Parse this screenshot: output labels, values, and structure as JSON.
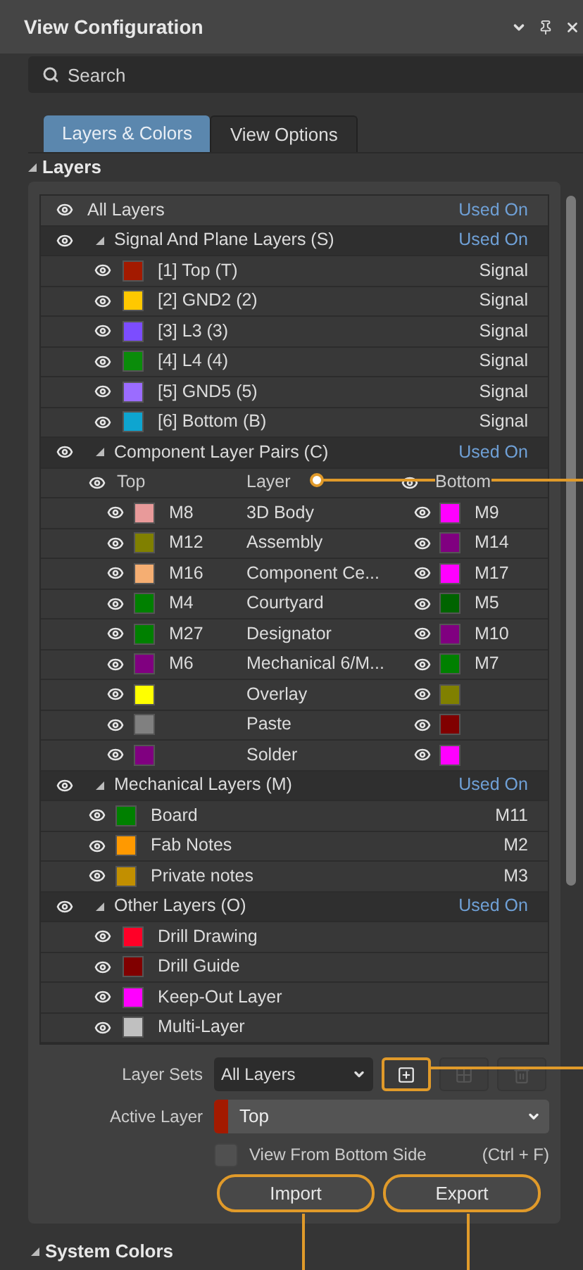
{
  "window": {
    "title": "View Configuration"
  },
  "search": {
    "placeholder": "Search"
  },
  "tabs": [
    {
      "label": "Layers & Colors",
      "selected": true
    },
    {
      "label": "View Options",
      "selected": false
    }
  ],
  "section": {
    "title": "Layers"
  },
  "tree": {
    "all_layers": {
      "label": "All Layers",
      "used_on": "Used On"
    },
    "groups": [
      {
        "kind": "signal",
        "label": "Signal And Plane Layers (S)",
        "used_on": "Used On",
        "children": [
          {
            "label": "[1] Top (T)",
            "color": "#a31a00",
            "value": "Signal"
          },
          {
            "label": "[2] GND2 (2)",
            "color": "#ffc800",
            "value": "Signal"
          },
          {
            "label": "[3] L3 (3)",
            "color": "#7c4dff",
            "value": "Signal"
          },
          {
            "label": "[4] L4 (4)",
            "color": "#0a8c0a",
            "value": "Signal"
          },
          {
            "label": "[5] GND5 (5)",
            "color": "#9b6cff",
            "value": "Signal"
          },
          {
            "label": "[6] Bottom (B)",
            "color": "#0ea5d0",
            "value": "Signal"
          }
        ]
      },
      {
        "kind": "pairs",
        "label": "Component Layer Pairs (C)",
        "used_on": "Used On",
        "header": {
          "top": "Top",
          "layer": "Layer",
          "bottom": "Bottom"
        },
        "children": [
          {
            "top": {
              "code": "M8",
              "color": "#e89a9a"
            },
            "layer": "3D Body",
            "bottom": {
              "code": "M9",
              "color": "#ff00ff"
            }
          },
          {
            "top": {
              "code": "M12",
              "color": "#808000"
            },
            "layer": "Assembly",
            "bottom": {
              "code": "M14",
              "color": "#800080"
            }
          },
          {
            "top": {
              "code": "M16",
              "color": "#f5ae72"
            },
            "layer": "Component Ce...",
            "bottom": {
              "code": "M17",
              "color": "#ff00ff"
            }
          },
          {
            "top": {
              "code": "M4",
              "color": "#008000"
            },
            "layer": "Courtyard",
            "bottom": {
              "code": "M5",
              "color": "#006400"
            }
          },
          {
            "top": {
              "code": "M27",
              "color": "#008000"
            },
            "layer": "Designator",
            "bottom": {
              "code": "M10",
              "color": "#800080"
            }
          },
          {
            "top": {
              "code": "M6",
              "color": "#800080"
            },
            "layer": "Mechanical 6/M...",
            "bottom": {
              "code": "M7",
              "color": "#008000"
            }
          },
          {
            "top": {
              "color": "#ffff00"
            },
            "layer": "Overlay",
            "bottom": {
              "color": "#808000"
            }
          },
          {
            "top": {
              "color": "#808080"
            },
            "layer": "Paste",
            "bottom": {
              "color": "#800000"
            }
          },
          {
            "top": {
              "color": "#800080"
            },
            "layer": "Solder",
            "bottom": {
              "color": "#ff00ff"
            }
          }
        ]
      },
      {
        "kind": "mechanical",
        "label": "Mechanical Layers (M)",
        "used_on": "Used On",
        "children": [
          {
            "label": "Board",
            "color": "#008000",
            "value": "M11"
          },
          {
            "label": "Fab Notes",
            "color": "#ff9900",
            "value": "M2"
          },
          {
            "label": "Private notes",
            "color": "#c28f00",
            "value": "M3"
          }
        ]
      },
      {
        "kind": "other",
        "label": "Other Layers (O)",
        "used_on": "Used On",
        "children": [
          {
            "label": "Drill Drawing",
            "color": "#ff0027"
          },
          {
            "label": "Drill Guide",
            "color": "#800000"
          },
          {
            "label": "Keep-Out Layer",
            "color": "#ff00ff"
          },
          {
            "label": "Multi-Layer",
            "color": "#c0c0c0"
          }
        ]
      }
    ]
  },
  "layer_sets": {
    "label": "Layer Sets",
    "value": "All Layers",
    "buttons": [
      {
        "kind": "add",
        "disabled": false
      },
      {
        "kind": "grid",
        "disabled": true
      },
      {
        "kind": "delete",
        "disabled": true
      }
    ]
  },
  "active_layer": {
    "label": "Active Layer",
    "value": "Top",
    "color": "#a31a00"
  },
  "view_from_bottom": {
    "label": "View From Bottom Side",
    "checked": false,
    "shortcut": "(Ctrl + F)"
  },
  "buttons": [
    "Import",
    "Export"
  ],
  "next_section": {
    "title": "System Colors"
  }
}
